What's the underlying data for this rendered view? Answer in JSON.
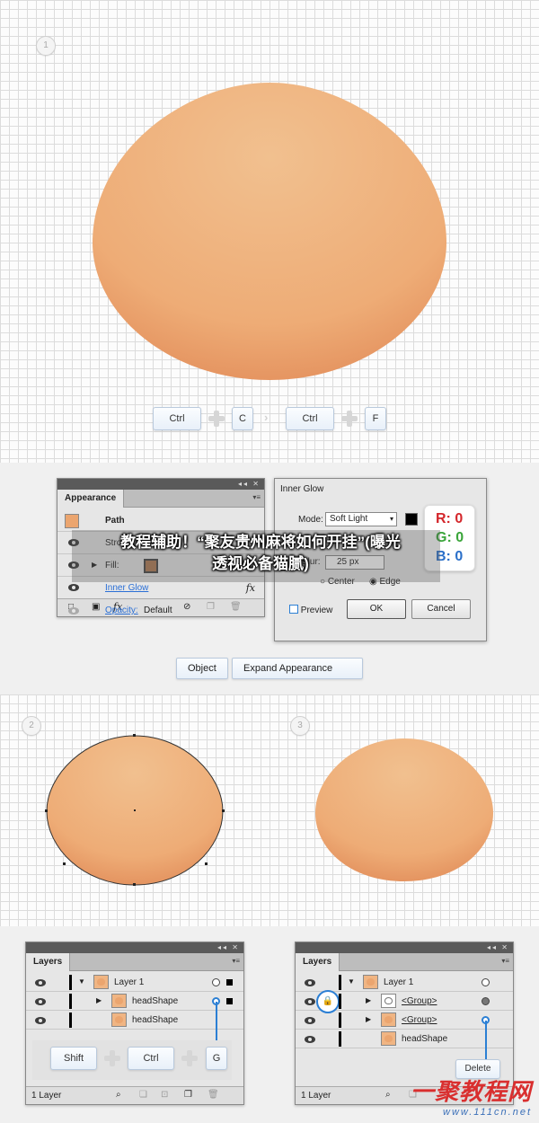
{
  "steps": {
    "s1": "1",
    "s2": "2",
    "s3": "3"
  },
  "shortcut1": {
    "k1": "Ctrl",
    "k2": "C",
    "k3": "Ctrl",
    "k4": "F"
  },
  "appearance": {
    "tab": "Appearance",
    "rows": {
      "path": "Path",
      "stroke": "Stroke:",
      "fill": "Fill:",
      "inner_glow": "Inner Glow",
      "opacity": "Opacity:",
      "opacity_value": "Default"
    },
    "fx": "fx"
  },
  "inner_glow": {
    "title": "Inner Glow",
    "mode_label": "Mode:",
    "mode_value": "Soft Light",
    "blur_label": "Blur:",
    "blur_value": "25 px",
    "center": "Center",
    "edge": "Edge",
    "preview": "Preview",
    "ok": "OK",
    "cancel": "Cancel"
  },
  "rgb": {
    "r": "R: 0",
    "g": "G: 0",
    "b": "B: 0",
    "r_color": "#d4262b",
    "g_color": "#3aa53a",
    "b_color": "#2a6fc9"
  },
  "menu_path": {
    "object": "Object",
    "expand": "Expand Appearance"
  },
  "layers_left": {
    "tab": "Layers",
    "rows": [
      {
        "name": "Layer 1"
      },
      {
        "name": "headShape"
      },
      {
        "name": "headShape"
      }
    ],
    "footer": "1 Layer"
  },
  "shortcut2": {
    "k1": "Shift",
    "k2": "Ctrl",
    "k3": "G"
  },
  "layers_right": {
    "tab": "Layers",
    "rows": [
      {
        "name": "Layer 1"
      },
      {
        "name": "<Group>"
      },
      {
        "name": "<Group>"
      },
      {
        "name": "headShape"
      }
    ],
    "delete": "Delete",
    "footer": "1 Layer"
  },
  "overlay": {
    "line1": "教程辅助！“聚友贵州麻将如何开挂”(曝光",
    "line2": "透视必备猫腻)"
  },
  "watermark": {
    "big": "一聚教程网",
    "small": "www.111cn.net"
  },
  "colors": {
    "head_fill": "#ebaa74",
    "accent_blue": "#2b7fd4"
  }
}
